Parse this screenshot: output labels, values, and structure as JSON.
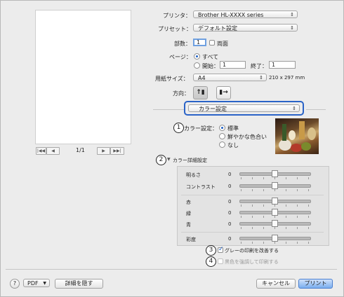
{
  "printer": {
    "label": "プリンタ：",
    "value": "Brother HL-XXXX series"
  },
  "preset": {
    "label": "プリセット：",
    "value": "デフォルト設定"
  },
  "copies": {
    "label": "部数：",
    "value": "1",
    "duplex_label": "両面"
  },
  "pages": {
    "label": "ページ：",
    "all_label": "すべて",
    "from_label": "開始：",
    "from_value": "1",
    "to_label": "終了：",
    "to_value": "1"
  },
  "paper": {
    "label": "用紙サイズ：",
    "value": "A4",
    "dims": "210 x 297 mm"
  },
  "orientation": {
    "label": "方向："
  },
  "panel_menu": {
    "value": "カラー設定"
  },
  "preview": {
    "page_indicator": "1/1"
  },
  "color_setting": {
    "label": "カラー設定：",
    "options": [
      "標準",
      "鮮やかな色合い",
      "なし"
    ],
    "selected": 0
  },
  "advanced": {
    "label": "カラー詳細設定"
  },
  "sliders": [
    {
      "label": "明るさ",
      "value": "0",
      "level": 0.5
    },
    {
      "label": "コントラスト",
      "value": "0",
      "level": 0.5
    },
    {
      "label": "赤",
      "value": "0",
      "level": 0.5
    },
    {
      "label": "緑",
      "value": "0",
      "level": 0.5
    },
    {
      "label": "青",
      "value": "0",
      "level": 0.5
    },
    {
      "label": "彩度",
      "value": "0",
      "level": 0.5
    }
  ],
  "options": {
    "gray_print": {
      "label": "グレーの印刷を改善する",
      "checked": true
    },
    "black_emphasis": {
      "label": "黒色を強調して印刷する",
      "checked": false,
      "enabled": false
    }
  },
  "callouts": [
    "1",
    "2",
    "3",
    "4"
  ],
  "footer": {
    "help": "?",
    "pdf": "PDF",
    "hide_details": "詳細を隠す",
    "cancel": "キャンセル",
    "print": "プリント"
  },
  "colors": {
    "accent": "#1d5fc4",
    "highlight_ring": "#2a63c7"
  }
}
